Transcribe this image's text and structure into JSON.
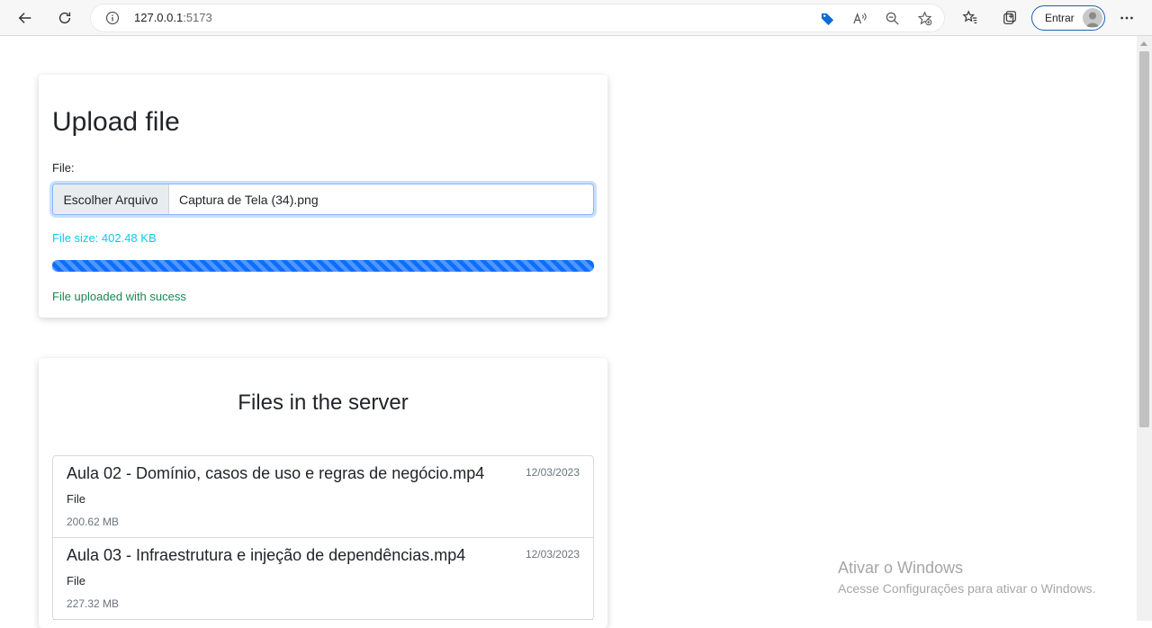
{
  "browser": {
    "url_host": "127.0.0.1",
    "url_port": ":5173",
    "signin_label": "Entrar",
    "colors": {
      "accent": "#1a5fb4",
      "coupon": "#0a6cd6"
    }
  },
  "upload": {
    "title": "Upload file",
    "field_label": "File:",
    "choose_button": "Escolher Arquivo",
    "selected_file": "Captura de Tela (34).png",
    "file_size": "File size: 402.48 KB",
    "progress": 1.0,
    "status_message": "File uploaded with sucess",
    "colors": {
      "size": "#0dcaf0",
      "progress": "#0d6efd",
      "success": "#198754"
    }
  },
  "files": {
    "title": "Files in the server",
    "items": [
      {
        "name": "Aula 02 - Domínio, casos de uso e regras de negócio.mp4",
        "date": "12/03/2023",
        "type": "File",
        "size": "200.62 MB"
      },
      {
        "name": "Aula 03 - Infraestrutura e injeção de dependências.mp4",
        "date": "12/03/2023",
        "type": "File",
        "size": "227.32 MB"
      }
    ]
  },
  "watermark": {
    "title": "Ativar o Windows",
    "subtitle": "Acesse Configurações para ativar o Windows."
  }
}
